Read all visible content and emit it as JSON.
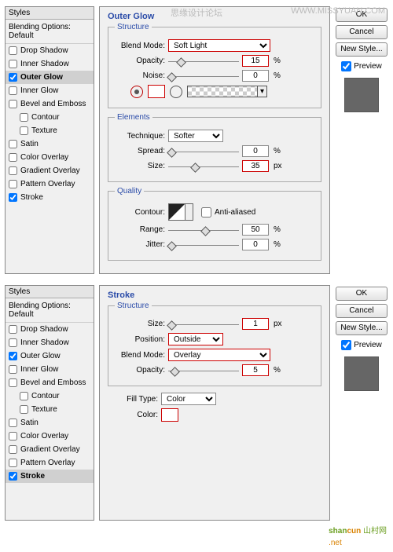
{
  "watermark_center": "思缘设计论坛",
  "watermark_right": "WWW.MISSYUAN.COM",
  "styles_panel": {
    "title": "Styles",
    "subtitle": "Blending Options: Default",
    "items": [
      {
        "label": "Drop Shadow",
        "checked": false
      },
      {
        "label": "Inner Shadow",
        "checked": false
      },
      {
        "label": "Outer Glow",
        "checked": true
      },
      {
        "label": "Inner Glow",
        "checked": false
      },
      {
        "label": "Bevel and Emboss",
        "checked": false
      },
      {
        "label": "Contour",
        "checked": false,
        "indent": true
      },
      {
        "label": "Texture",
        "checked": false,
        "indent": true
      },
      {
        "label": "Satin",
        "checked": false
      },
      {
        "label": "Color Overlay",
        "checked": false
      },
      {
        "label": "Gradient Overlay",
        "checked": false
      },
      {
        "label": "Pattern Overlay",
        "checked": false
      },
      {
        "label": "Stroke",
        "checked": true
      }
    ]
  },
  "outer_glow": {
    "title": "Outer Glow",
    "structure": {
      "legend": "Structure",
      "blend_mode_label": "Blend Mode:",
      "blend_mode": "Soft Light",
      "opacity_label": "Opacity:",
      "opacity": "15",
      "noise_label": "Noise:",
      "noise": "0"
    },
    "elements": {
      "legend": "Elements",
      "technique_label": "Technique:",
      "technique": "Softer",
      "spread_label": "Spread:",
      "spread": "0",
      "size_label": "Size:",
      "size": "35"
    },
    "quality": {
      "legend": "Quality",
      "contour_label": "Contour:",
      "anti_aliased": "Anti-aliased",
      "range_label": "Range:",
      "range": "50",
      "jitter_label": "Jitter:",
      "jitter": "0"
    }
  },
  "stroke_panel": {
    "title": "Stroke",
    "structure": {
      "legend": "Structure",
      "size_label": "Size:",
      "size": "1",
      "position_label": "Position:",
      "position": "Outside",
      "blend_mode_label": "Blend Mode:",
      "blend_mode": "Overlay",
      "opacity_label": "Opacity:",
      "opacity": "5"
    },
    "fill_type_label": "Fill Type:",
    "fill_type": "Color",
    "color_label": "Color:"
  },
  "side": {
    "ok": "OK",
    "cancel": "Cancel",
    "new_style": "New Style...",
    "preview": "Preview"
  },
  "pct": "%",
  "px": "px",
  "logo_shan": "shan",
  "logo_cun": "cun",
  "logo_side": "山村网",
  "logo_net": ".net"
}
